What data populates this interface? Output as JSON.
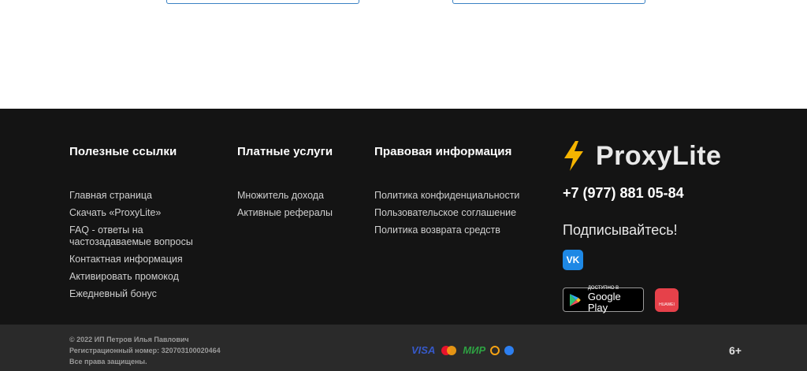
{
  "footer": {
    "useful": {
      "title": "Полезные ссылки",
      "links": [
        "Главная страница",
        "Скачать «ProxyLite»",
        "FAQ - ответы на частозадаваемые вопросы",
        "Контактная информация",
        "Активировать промокод",
        "Ежедневный бонус"
      ]
    },
    "paid": {
      "title": "Платные услуги",
      "links": [
        "Множитель дохода",
        "Активные рефералы"
      ]
    },
    "legal": {
      "title": "Правовая информация",
      "links": [
        "Политика конфиденциальности",
        "Пользовательское соглашение",
        "Политика возврата средств"
      ]
    },
    "brand": {
      "name": "ProxyLite",
      "phone": "+7 (977) 881 05-84",
      "subscribe": "Подписывайтесь!",
      "vk_label": "VK",
      "google_play_small": "ДОСТУПНО В",
      "google_play_big": "Google Play",
      "huawei_label": "HUAWEI"
    }
  },
  "bottom": {
    "copyright": "© 2022 ИП Петров Илья Павлович",
    "reg": "Регистрационный номер: 320703100020464",
    "rights": "Все права защищены.",
    "visa": "VISA",
    "mir": "МИР",
    "age": "6+"
  },
  "colors": {
    "footer_bg": "#141414",
    "bottom_bg": "#2a2a2a",
    "logo_bolt": "#f5b400",
    "vk": "#1e88e5"
  }
}
